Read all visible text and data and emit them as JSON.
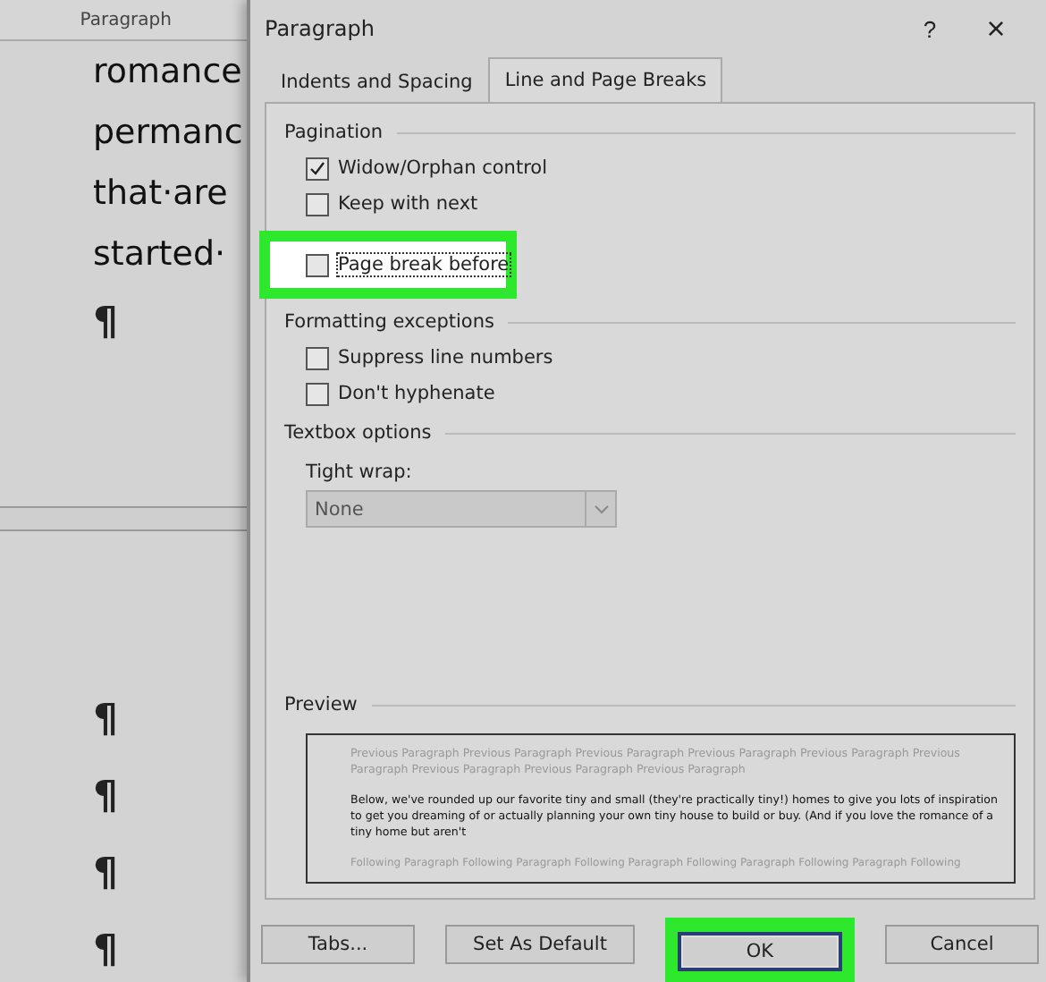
{
  "document": {
    "ribbon_group": "Paragraph",
    "lines": [
      "romance",
      "permanc",
      "that·are",
      "started·"
    ],
    "marks_top": [
      "¶"
    ],
    "marks_bottom": [
      "¶",
      "¶",
      "¶",
      "¶"
    ]
  },
  "dialog": {
    "title": "Paragraph",
    "help": "?",
    "close": "×",
    "tabs": [
      {
        "label": "Indents and Spacing",
        "selected": false
      },
      {
        "label": "Line and Page Breaks",
        "selected": true
      }
    ],
    "pagination": {
      "title": "Pagination",
      "options": [
        {
          "label": "Widow/Orphan control",
          "checked": true,
          "highlighted": false
        },
        {
          "label": "Keep with next",
          "checked": false,
          "highlighted": false
        },
        {
          "label": "Page break before",
          "checked": false,
          "highlighted": true
        }
      ]
    },
    "formatting": {
      "title": "Formatting exceptions",
      "options": [
        {
          "label": "Suppress line numbers",
          "checked": false,
          "highlighted": false
        },
        {
          "label": "Don't hyphenate",
          "checked": false,
          "highlighted": false
        }
      ]
    },
    "textbox": {
      "title": "Textbox options",
      "field_label": "Tight wrap:",
      "value": "None"
    },
    "preview": {
      "title": "Preview",
      "previous": "Previous Paragraph Previous Paragraph Previous Paragraph Previous Paragraph Previous Paragraph Previous Paragraph Previous Paragraph Previous Paragraph Previous Paragraph",
      "current": "Below, we've rounded up our favorite tiny and small (they're practically tiny!) homes to give you lots of inspiration to get you dreaming of or actually planning your own tiny house to build or buy. (And if you love the romance of a tiny home but aren't",
      "following": "Following Paragraph Following Paragraph Following Paragraph Following Paragraph Following Paragraph Following"
    },
    "buttons": [
      {
        "label": "Tabs...",
        "kind": "plain",
        "highlighted": false
      },
      {
        "label": "Set As Default",
        "kind": "plain",
        "highlighted": false
      },
      {
        "label": "OK",
        "kind": "default",
        "highlighted": true
      },
      {
        "label": "Cancel",
        "kind": "plain",
        "highlighted": false
      }
    ]
  }
}
